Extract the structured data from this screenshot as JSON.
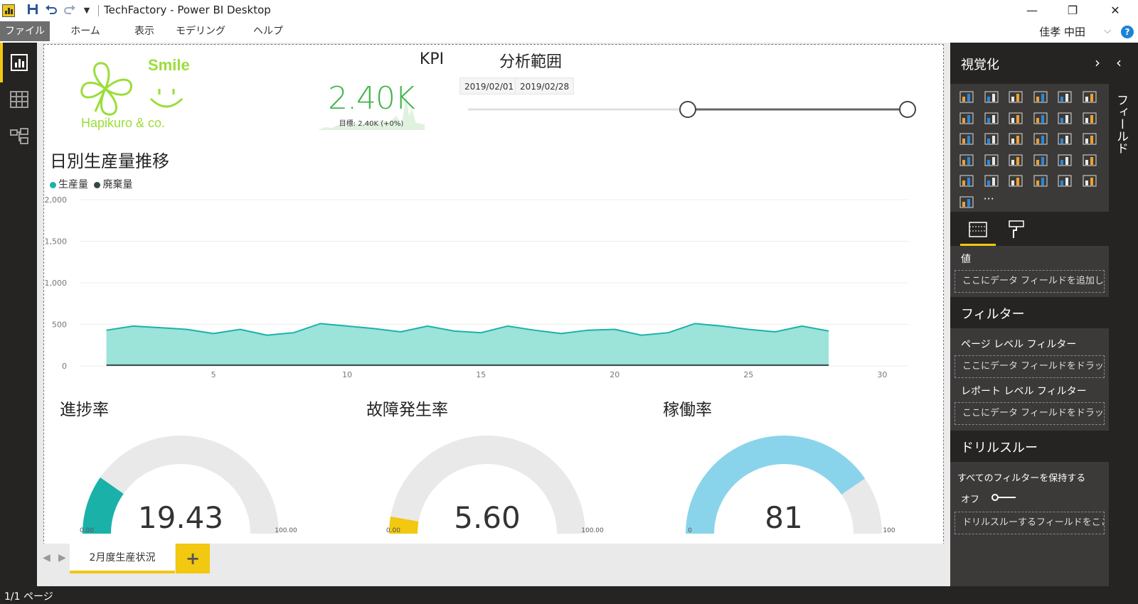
{
  "window": {
    "title": "TechFactory - Power BI Desktop",
    "minimize": "—",
    "restore": "❐",
    "close": "✕"
  },
  "menu": {
    "items": [
      "ファイル",
      "ホーム",
      "表示",
      "モデリング",
      "ヘルプ"
    ],
    "user": "佳孝 中田",
    "help": "?"
  },
  "logo": {
    "text_top": "Smile",
    "text_bottom": "Hapikuro & co.",
    "color": "#9bdd3a"
  },
  "kpi": {
    "title": "KPI",
    "value": "2.40K",
    "goal": "目標: 2.40K (+0%)"
  },
  "slicer": {
    "title": "分析範囲",
    "start": "2019/02/01",
    "end": "2019/02/28",
    "range_start_fraction": 0.5,
    "range_end_fraction": 1.0
  },
  "chart_data": {
    "type": "area",
    "title": "日別生産量推移",
    "xlabel": "",
    "ylabel": "",
    "series": [
      {
        "name": "生産量",
        "color": "#1ab2a8",
        "fill": "#9ce3da",
        "values": [
          430,
          480,
          460,
          440,
          390,
          440,
          370,
          400,
          510,
          480,
          450,
          410,
          480,
          420,
          400,
          480,
          430,
          390,
          430,
          440,
          370,
          400,
          510,
          480,
          440,
          410,
          480,
          420
        ]
      },
      {
        "name": "廃棄量",
        "color": "#374649",
        "values": [
          10,
          10,
          10,
          10,
          10,
          10,
          10,
          10,
          10,
          10,
          10,
          10,
          10,
          10,
          10,
          10,
          10,
          10,
          10,
          10,
          10,
          10,
          10,
          10,
          10,
          10,
          10,
          10
        ]
      }
    ],
    "x": [
      1,
      2,
      3,
      4,
      5,
      6,
      7,
      8,
      9,
      10,
      11,
      12,
      13,
      14,
      15,
      16,
      17,
      18,
      19,
      20,
      21,
      22,
      23,
      24,
      25,
      26,
      27,
      28
    ],
    "xlim": [
      0,
      31
    ],
    "ylim": [
      0,
      2000
    ],
    "y_ticks": [
      "0",
      "500",
      "1,000",
      "1,500",
      "2,000"
    ],
    "x_ticks": [
      "5",
      "10",
      "15",
      "20",
      "25",
      "30"
    ],
    "grid": true,
    "legend": "top-left"
  },
  "gauges": [
    {
      "title": "進捗率",
      "value": 19.43,
      "display": "19.43",
      "min": 0,
      "max": 100,
      "min_label": "0.00",
      "max_label": "100.00",
      "color": "#1ab2a8"
    },
    {
      "title": "故障発生率",
      "value": 5.6,
      "display": "5.60",
      "min": 0,
      "max": 100,
      "min_label": "0.00",
      "max_label": "100.00",
      "color": "#f2c811"
    },
    {
      "title": "稼働率",
      "value": 81,
      "display": "81",
      "min": 0,
      "max": 100,
      "min_label": "0",
      "max_label": "100",
      "color": "#8ad4eb"
    }
  ],
  "viz_panel": {
    "title": "視覚化",
    "values_label": "値",
    "values_drop": "ここにデータ フィールドを追加して...",
    "filters_title": "フィルター",
    "page_filter_label": "ページ レベル フィルター",
    "page_filter_drop": "ここにデータ フィールドをドラッグ...",
    "report_filter_label": "レポート レベル フィルター",
    "report_filter_drop": "ここにデータ フィールドをドラッグ...",
    "drill_title": "ドリルスルー",
    "keep_filters_label": "すべてのフィルターを保持する",
    "toggle_label": "オフ",
    "drill_drop": "ドリルスルーするフィールドをここ...",
    "more": "···"
  },
  "fields_panel": {
    "label": "フィールド"
  },
  "pages": {
    "tab": "2月度生産状況",
    "add": "+"
  },
  "status": {
    "page_count": "1/1 ページ"
  }
}
